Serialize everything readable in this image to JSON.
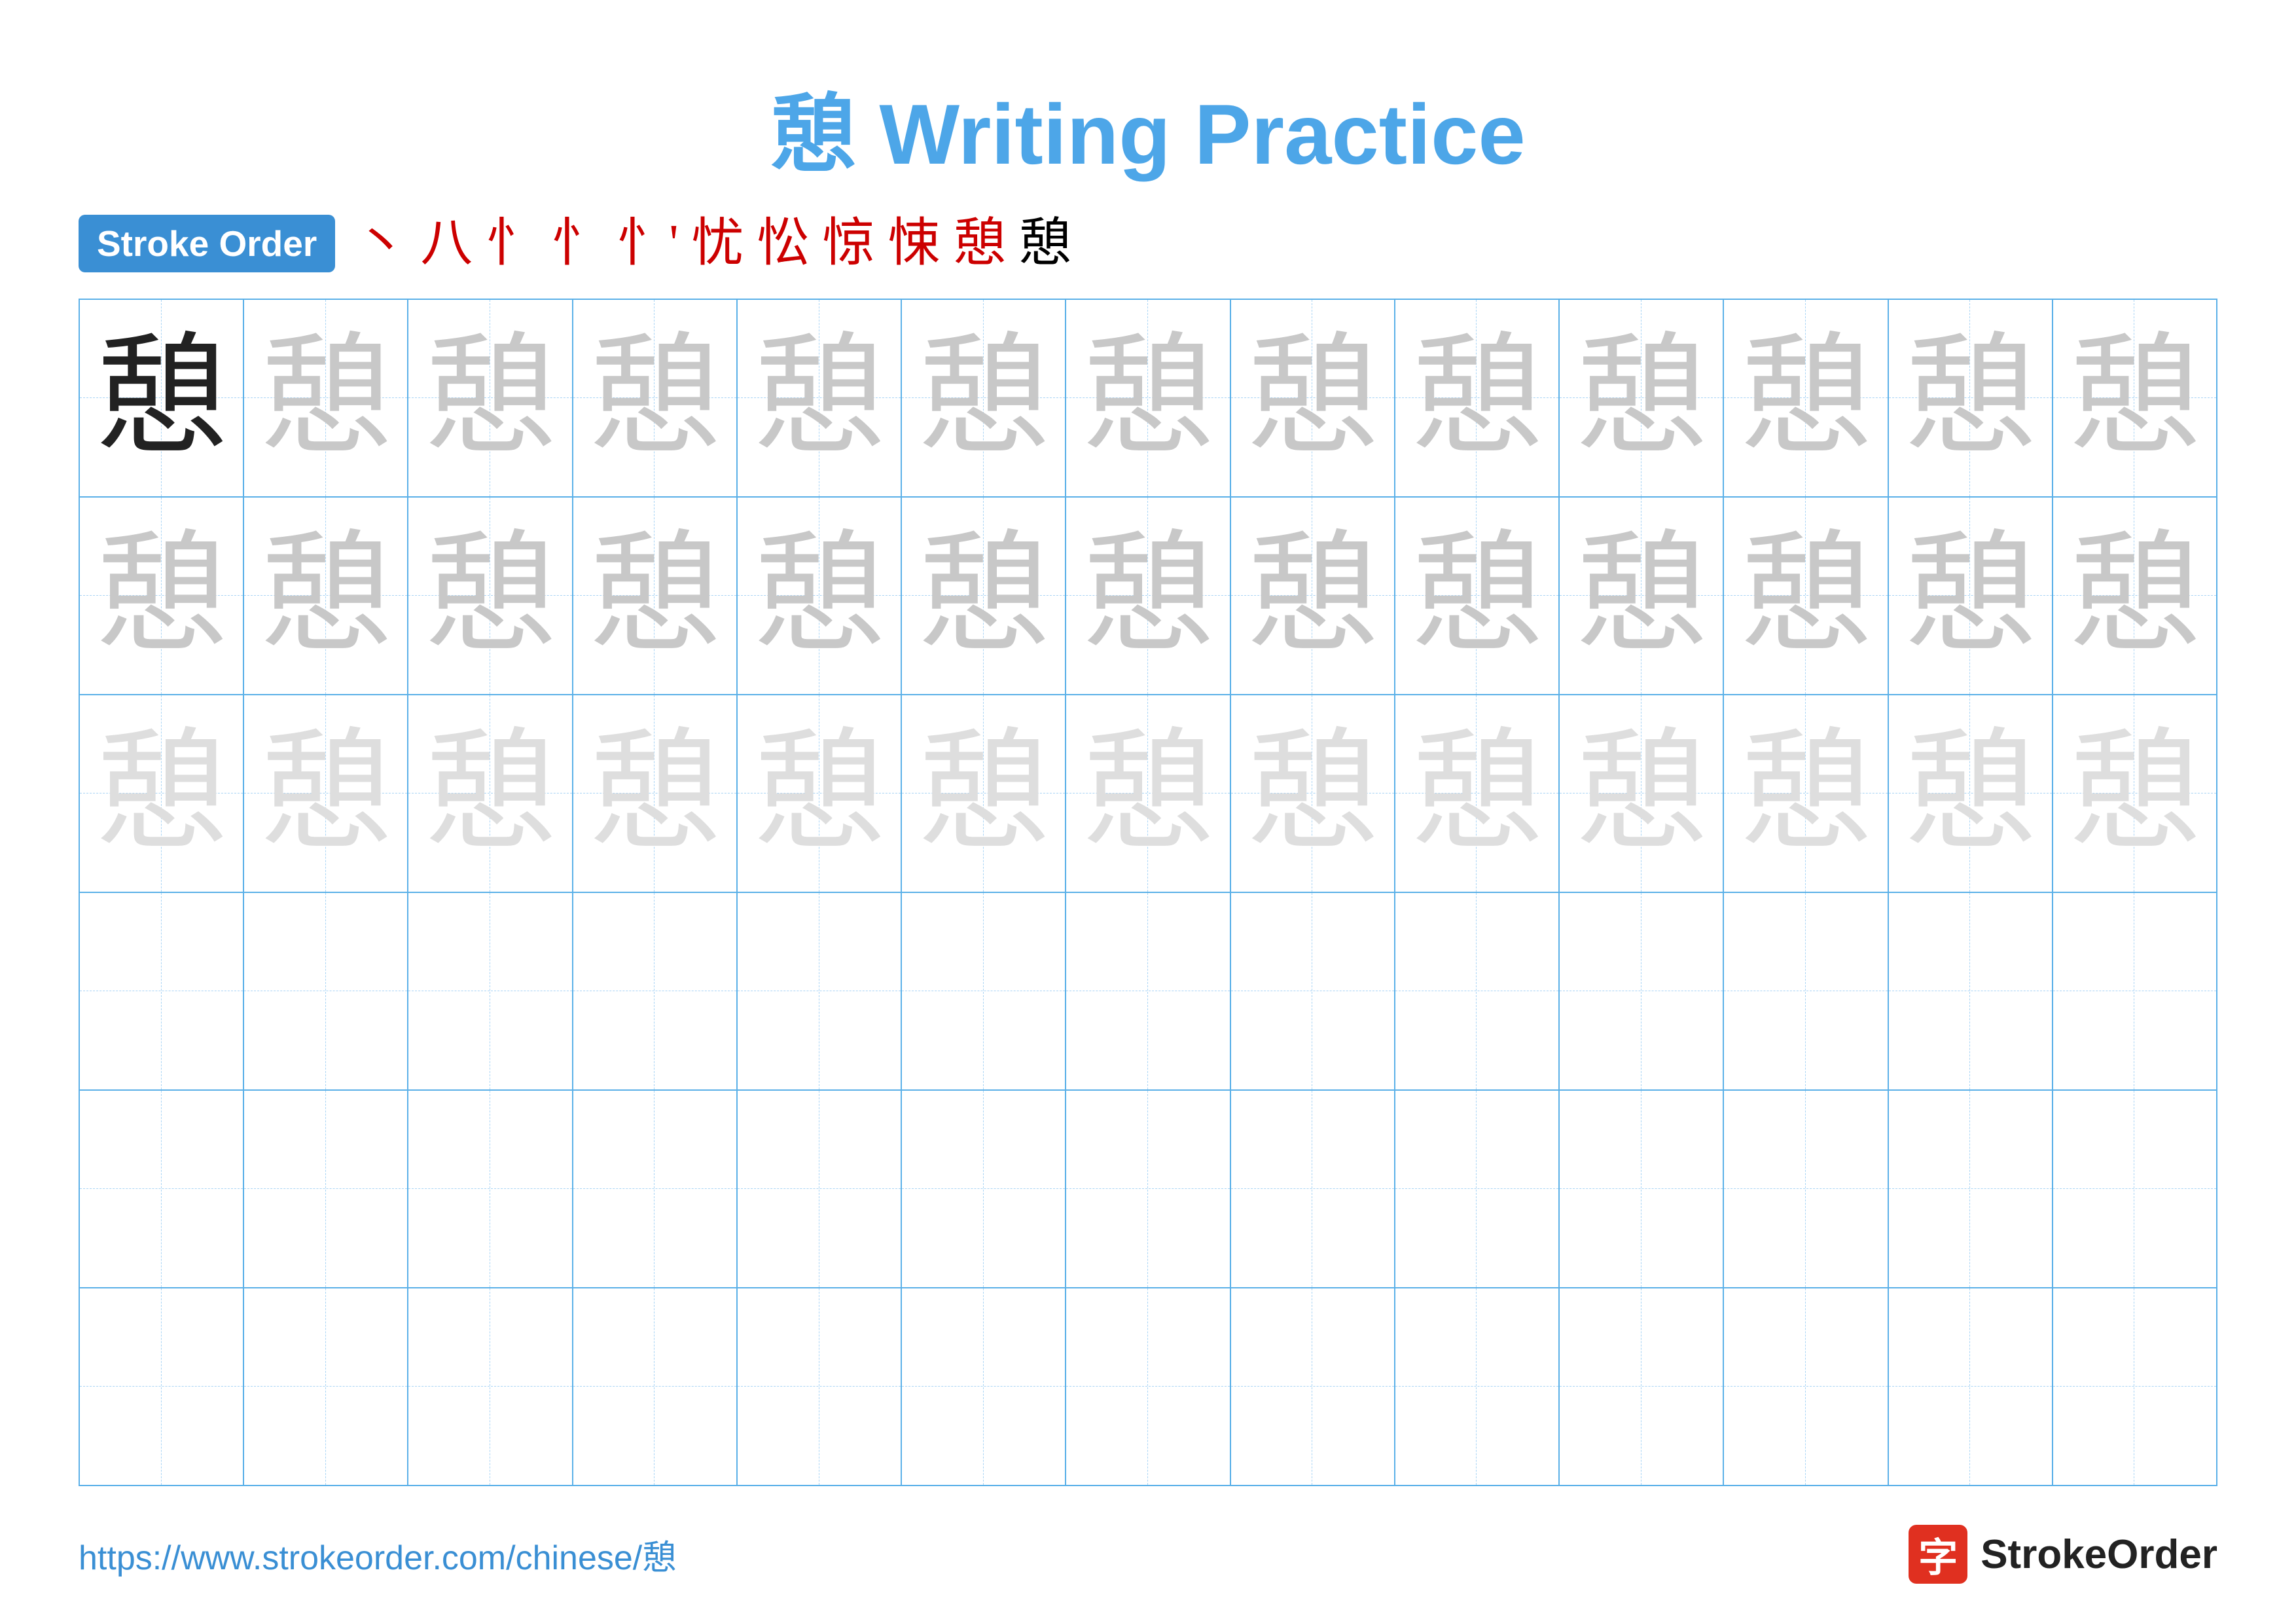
{
  "page": {
    "title": "憩 Writing Practice",
    "title_char": "憩",
    "title_suffix": " Writing Practice",
    "bg_color": "#ffffff"
  },
  "stroke_order": {
    "badge_label": "Stroke Order",
    "steps": [
      "丶",
      "八",
      "忄",
      "忄",
      "忄'",
      "忧",
      "忪",
      "惊",
      "悚",
      "憩",
      "憩"
    ]
  },
  "grid": {
    "rows": 6,
    "cols": 13,
    "char": "憩",
    "row_types": [
      "dark-then-medium",
      "light",
      "lighter",
      "empty",
      "empty",
      "empty"
    ]
  },
  "footer": {
    "url": "https://www.strokeorder.com/chinese/憩",
    "logo_char": "字",
    "logo_text": "StrokeOrder"
  }
}
